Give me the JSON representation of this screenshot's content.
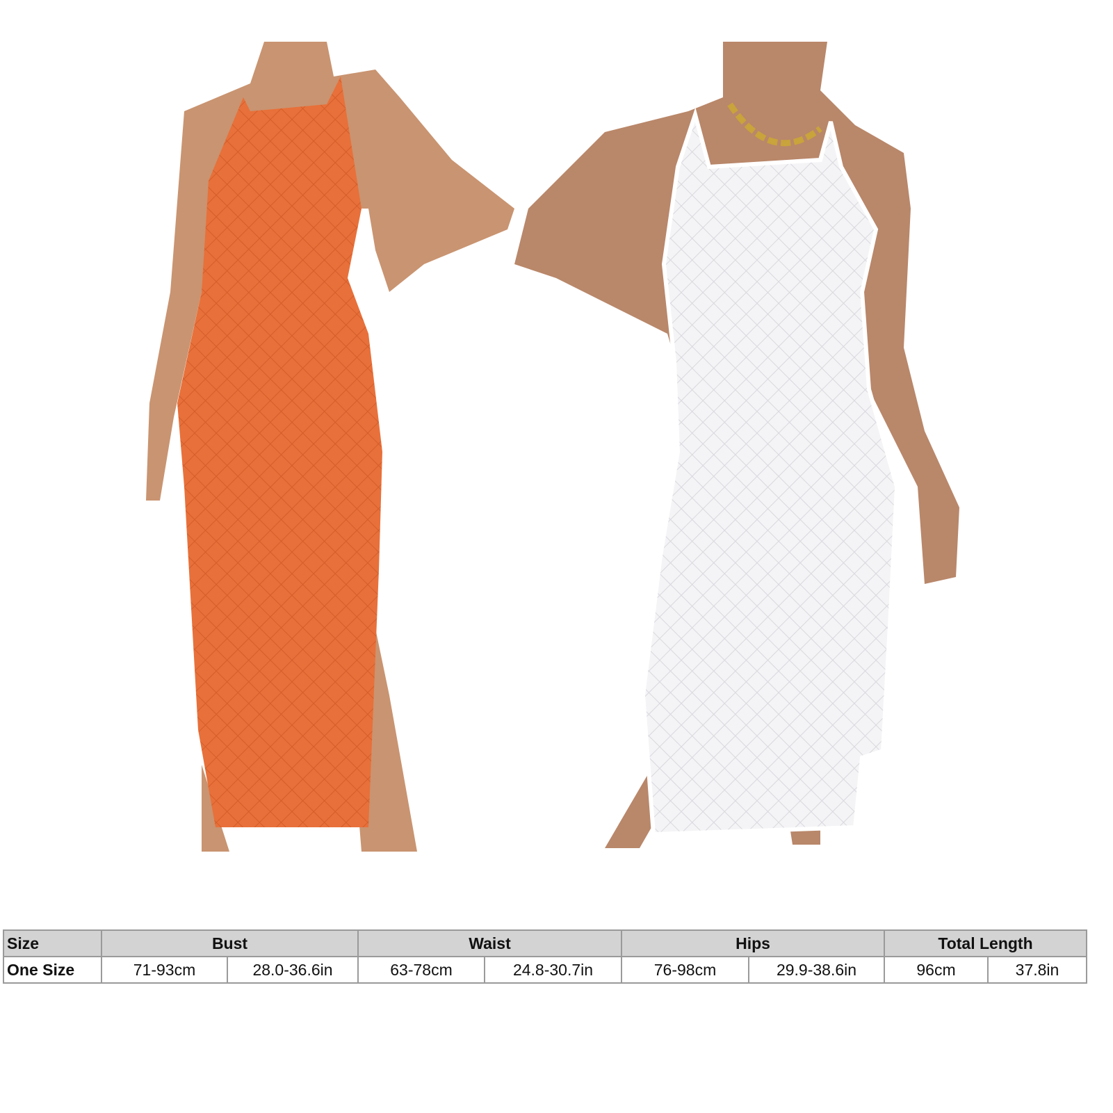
{
  "product_images": [
    {
      "color_name": "orange",
      "color": "#e8703a"
    },
    {
      "color_name": "white",
      "color": "#f4f4f6"
    }
  ],
  "size_table": {
    "headers": [
      "Size",
      "Bust",
      "Waist",
      "Hips",
      "Total Length"
    ],
    "row": {
      "size": "One Size",
      "bust_cm": "71-93cm",
      "bust_in": "28.0-36.6in",
      "waist_cm": "63-78cm",
      "waist_in": "24.8-30.7in",
      "hips_cm": "76-98cm",
      "hips_in": "29.9-38.6in",
      "length_cm": "96cm",
      "length_in": "37.8in"
    }
  }
}
